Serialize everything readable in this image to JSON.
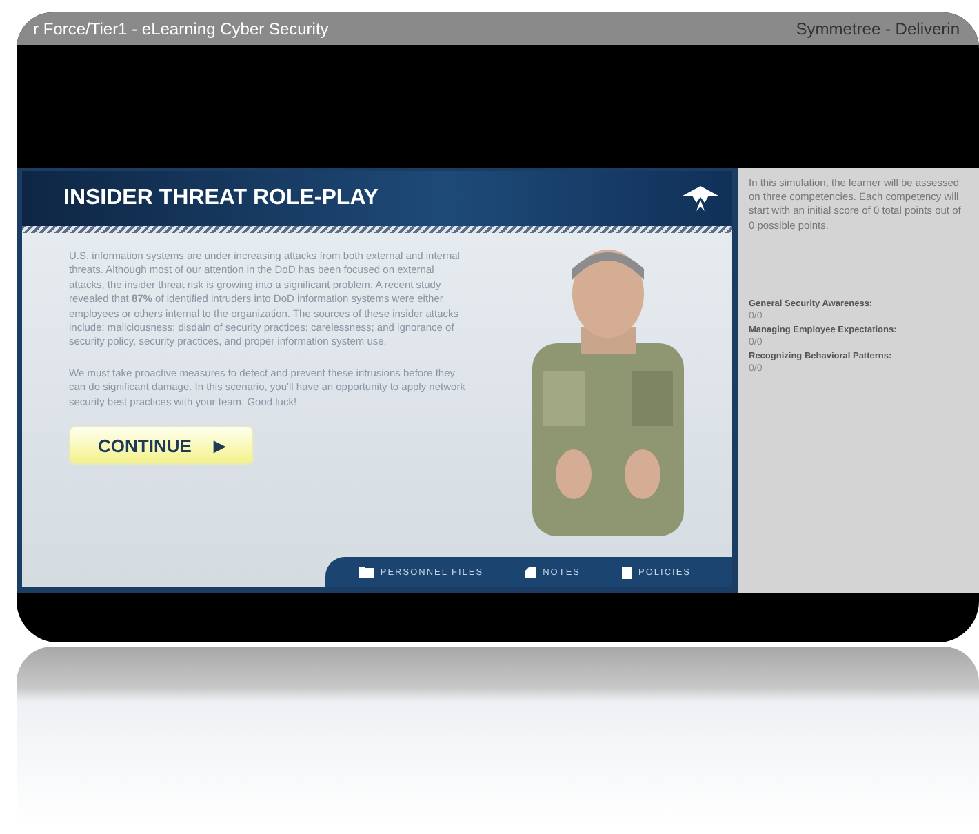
{
  "window": {
    "title": "r Force/Tier1 - eLearning Cyber Security",
    "title_right": "Symmetree - Deliverin"
  },
  "lesson": {
    "title": "INSIDER THREAT ROLE-PLAY",
    "paragraphs": [
      "U.S. information systems are under increasing attacks from both external and internal threats. Although most of our attention in the DoD has been focused on external attacks, the insider threat risk is growing into a significant problem. A recent study revealed that **87%** of identified intruders into DoD information systems were either employees or others internal to the organization. The sources of these insider attacks include: maliciousness; disdain of security practices; carelessness; and ignorance of security policy, security practices, and proper information system use.",
      "We must take proactive measures to detect and prevent these intrusions before they can do significant damage. In this scenario, you'll have an opportunity to apply network security best practices with your team. Good luck!"
    ],
    "continue_button": "CONTINUE",
    "continue_icon": "▶",
    "nav": [
      {
        "kind": "folder",
        "label": "PERSONNEL FILES"
      },
      {
        "kind": "note",
        "label": "NOTES"
      },
      {
        "kind": "page",
        "label": "POLICIES"
      }
    ]
  },
  "sidebar": {
    "intro": "In this simulation, the learner will be assessed on three competencies. Each competency will start with an initial score of 0 total points out of 0 possible points.",
    "competencies": [
      {
        "name": "General Security Awareness:",
        "score": "0/0"
      },
      {
        "name": "Managing  Employee Expectations:",
        "score": "0/0"
      },
      {
        "name": "Recognizing Behavioral Patterns:",
        "score": "0/0"
      }
    ]
  }
}
